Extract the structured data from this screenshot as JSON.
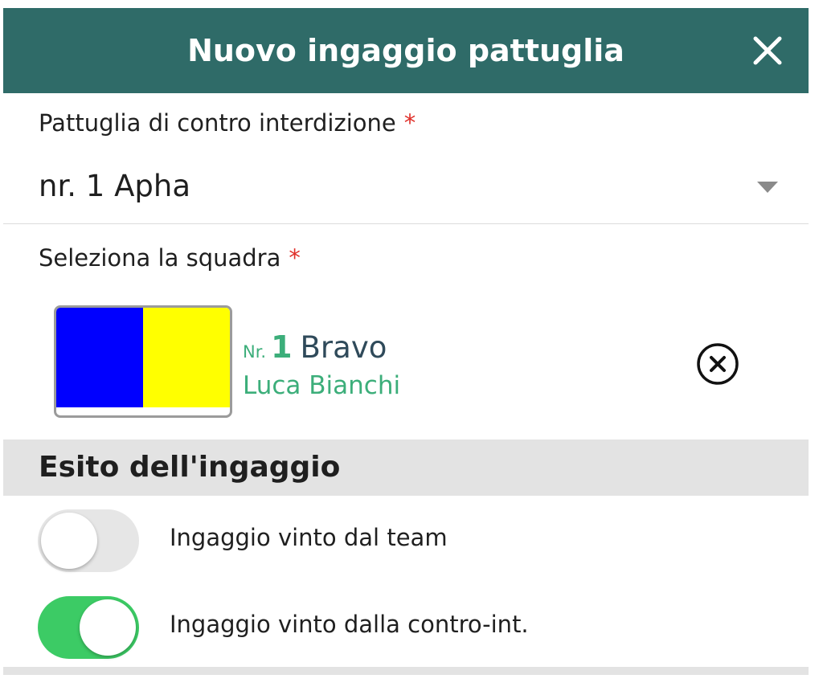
{
  "dialog": {
    "title": "Nuovo ingaggio pattuglia",
    "header_color": "#2f6b68",
    "close_icon": "close-icon"
  },
  "patrol_field": {
    "label": "Pattuglia di contro interdizione",
    "required_mark": "*",
    "value": "nr. 1 Apha",
    "dropdown_icon": "caret-down-icon"
  },
  "team_field": {
    "label": "Seleziona la squadra",
    "required_mark": "*",
    "selected_team": {
      "number_prefix": "Nr.",
      "number": "1",
      "name": "Bravo",
      "leader": "Luca Bianchi",
      "flag_colors": [
        "#0000ff",
        "#ffff00"
      ]
    },
    "remove_icon": "circle-x-icon"
  },
  "outcome": {
    "title": "Esito dell'ingaggio",
    "toggles": [
      {
        "label": "Ingaggio vinto dal team",
        "on": false
      },
      {
        "label": "Ingaggio vinto dalla contro-int.",
        "on": true
      }
    ]
  },
  "colors": {
    "accent_green": "#3cae7a",
    "toggle_on": "#3ccb65",
    "required_red": "#e0302a"
  }
}
